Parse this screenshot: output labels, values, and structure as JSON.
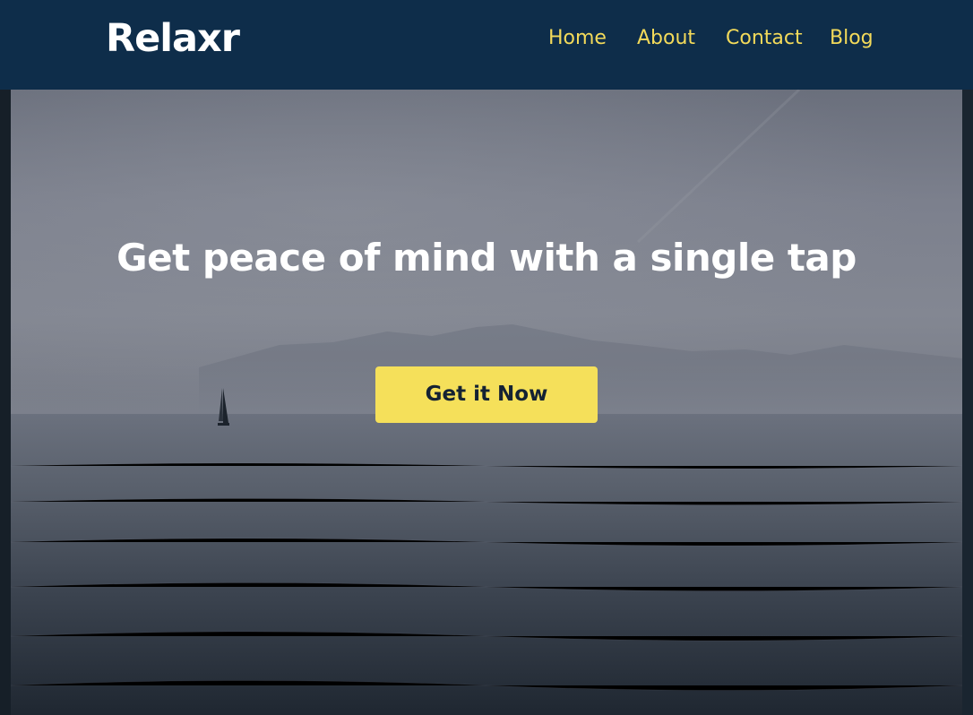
{
  "header": {
    "logo": "Relaxr",
    "nav": [
      {
        "label": "Home"
      },
      {
        "label": "About"
      },
      {
        "label": "Contact"
      },
      {
        "label": "Blog"
      }
    ]
  },
  "hero": {
    "headline": "Get peace of mind with a single tap",
    "cta_label": "Get it Now",
    "background_image": "misty lake with mountains and a sailboat"
  },
  "colors": {
    "header_bg": "#0e2d4a",
    "accent": "#f3da5a",
    "button_bg": "#f5e05a",
    "button_text": "#142233"
  }
}
